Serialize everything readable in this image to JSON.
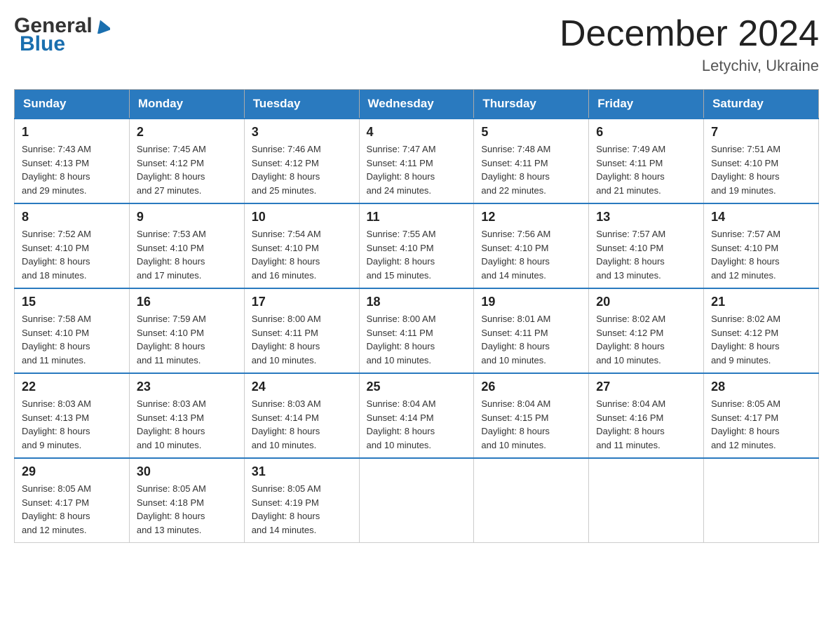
{
  "logo": {
    "general": "General",
    "blue": "Blue"
  },
  "title": "December 2024",
  "subtitle": "Letychiv, Ukraine",
  "days_header": [
    "Sunday",
    "Monday",
    "Tuesday",
    "Wednesday",
    "Thursday",
    "Friday",
    "Saturday"
  ],
  "weeks": [
    [
      {
        "day": "1",
        "sunrise": "7:43 AM",
        "sunset": "4:13 PM",
        "daylight": "8 hours and 29 minutes."
      },
      {
        "day": "2",
        "sunrise": "7:45 AM",
        "sunset": "4:12 PM",
        "daylight": "8 hours and 27 minutes."
      },
      {
        "day": "3",
        "sunrise": "7:46 AM",
        "sunset": "4:12 PM",
        "daylight": "8 hours and 25 minutes."
      },
      {
        "day": "4",
        "sunrise": "7:47 AM",
        "sunset": "4:11 PM",
        "daylight": "8 hours and 24 minutes."
      },
      {
        "day": "5",
        "sunrise": "7:48 AM",
        "sunset": "4:11 PM",
        "daylight": "8 hours and 22 minutes."
      },
      {
        "day": "6",
        "sunrise": "7:49 AM",
        "sunset": "4:11 PM",
        "daylight": "8 hours and 21 minutes."
      },
      {
        "day": "7",
        "sunrise": "7:51 AM",
        "sunset": "4:10 PM",
        "daylight": "8 hours and 19 minutes."
      }
    ],
    [
      {
        "day": "8",
        "sunrise": "7:52 AM",
        "sunset": "4:10 PM",
        "daylight": "8 hours and 18 minutes."
      },
      {
        "day": "9",
        "sunrise": "7:53 AM",
        "sunset": "4:10 PM",
        "daylight": "8 hours and 17 minutes."
      },
      {
        "day": "10",
        "sunrise": "7:54 AM",
        "sunset": "4:10 PM",
        "daylight": "8 hours and 16 minutes."
      },
      {
        "day": "11",
        "sunrise": "7:55 AM",
        "sunset": "4:10 PM",
        "daylight": "8 hours and 15 minutes."
      },
      {
        "day": "12",
        "sunrise": "7:56 AM",
        "sunset": "4:10 PM",
        "daylight": "8 hours and 14 minutes."
      },
      {
        "day": "13",
        "sunrise": "7:57 AM",
        "sunset": "4:10 PM",
        "daylight": "8 hours and 13 minutes."
      },
      {
        "day": "14",
        "sunrise": "7:57 AM",
        "sunset": "4:10 PM",
        "daylight": "8 hours and 12 minutes."
      }
    ],
    [
      {
        "day": "15",
        "sunrise": "7:58 AM",
        "sunset": "4:10 PM",
        "daylight": "8 hours and 11 minutes."
      },
      {
        "day": "16",
        "sunrise": "7:59 AM",
        "sunset": "4:10 PM",
        "daylight": "8 hours and 11 minutes."
      },
      {
        "day": "17",
        "sunrise": "8:00 AM",
        "sunset": "4:11 PM",
        "daylight": "8 hours and 10 minutes."
      },
      {
        "day": "18",
        "sunrise": "8:00 AM",
        "sunset": "4:11 PM",
        "daylight": "8 hours and 10 minutes."
      },
      {
        "day": "19",
        "sunrise": "8:01 AM",
        "sunset": "4:11 PM",
        "daylight": "8 hours and 10 minutes."
      },
      {
        "day": "20",
        "sunrise": "8:02 AM",
        "sunset": "4:12 PM",
        "daylight": "8 hours and 10 minutes."
      },
      {
        "day": "21",
        "sunrise": "8:02 AM",
        "sunset": "4:12 PM",
        "daylight": "8 hours and 9 minutes."
      }
    ],
    [
      {
        "day": "22",
        "sunrise": "8:03 AM",
        "sunset": "4:13 PM",
        "daylight": "8 hours and 9 minutes."
      },
      {
        "day": "23",
        "sunrise": "8:03 AM",
        "sunset": "4:13 PM",
        "daylight": "8 hours and 10 minutes."
      },
      {
        "day": "24",
        "sunrise": "8:03 AM",
        "sunset": "4:14 PM",
        "daylight": "8 hours and 10 minutes."
      },
      {
        "day": "25",
        "sunrise": "8:04 AM",
        "sunset": "4:14 PM",
        "daylight": "8 hours and 10 minutes."
      },
      {
        "day": "26",
        "sunrise": "8:04 AM",
        "sunset": "4:15 PM",
        "daylight": "8 hours and 10 minutes."
      },
      {
        "day": "27",
        "sunrise": "8:04 AM",
        "sunset": "4:16 PM",
        "daylight": "8 hours and 11 minutes."
      },
      {
        "day": "28",
        "sunrise": "8:05 AM",
        "sunset": "4:17 PM",
        "daylight": "8 hours and 12 minutes."
      }
    ],
    [
      {
        "day": "29",
        "sunrise": "8:05 AM",
        "sunset": "4:17 PM",
        "daylight": "8 hours and 12 minutes."
      },
      {
        "day": "30",
        "sunrise": "8:05 AM",
        "sunset": "4:18 PM",
        "daylight": "8 hours and 13 minutes."
      },
      {
        "day": "31",
        "sunrise": "8:05 AM",
        "sunset": "4:19 PM",
        "daylight": "8 hours and 14 minutes."
      },
      null,
      null,
      null,
      null
    ]
  ],
  "labels": {
    "sunrise": "Sunrise: ",
    "sunset": "Sunset: ",
    "daylight": "Daylight: "
  }
}
